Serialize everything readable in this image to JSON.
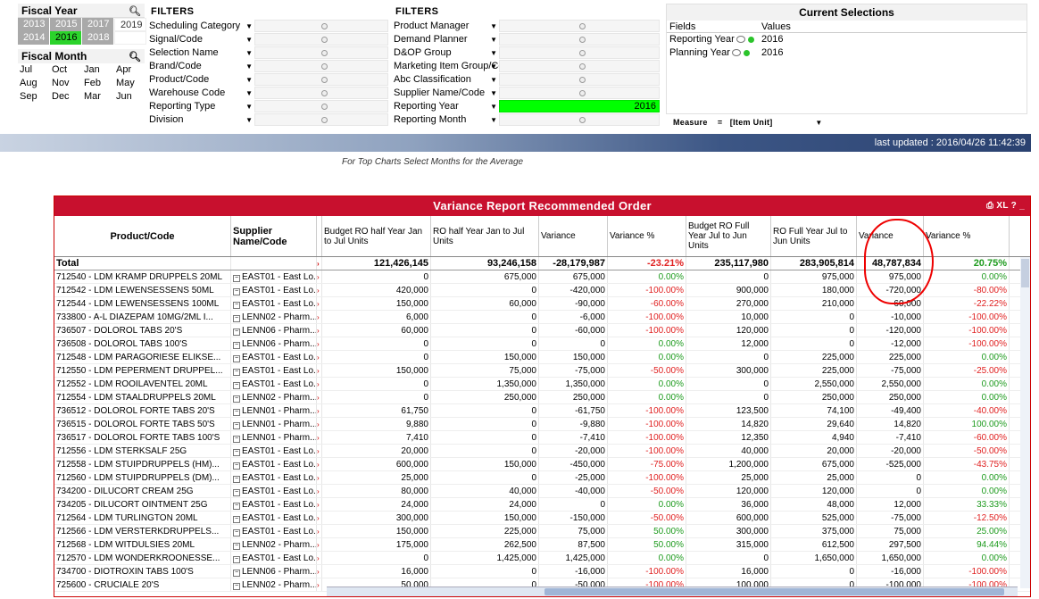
{
  "fiscal_year": {
    "title": "Fiscal Year",
    "years": [
      {
        "label": "2013",
        "state": "gray"
      },
      {
        "label": "2015",
        "state": "gray"
      },
      {
        "label": "2017",
        "state": "gray"
      },
      {
        "label": "2019",
        "state": "white"
      },
      {
        "label": "2014",
        "state": "gray"
      },
      {
        "label": "2016",
        "state": "sel"
      },
      {
        "label": "2018",
        "state": "gray"
      },
      {
        "label": "",
        "state": "white"
      }
    ]
  },
  "fiscal_month": {
    "title": "Fiscal Month",
    "months": [
      "Jul",
      "Oct",
      "Jan",
      "Apr",
      "Aug",
      "Nov",
      "Feb",
      "May",
      "Sep",
      "Dec",
      "Mar",
      "Jun"
    ]
  },
  "filters1": {
    "title": "FILTERS",
    "rows": [
      {
        "label": "Scheduling Category",
        "value": ""
      },
      {
        "label": "Signal/Code",
        "value": ""
      },
      {
        "label": "Selection Name",
        "value": ""
      },
      {
        "label": "Brand/Code",
        "value": ""
      },
      {
        "label": "Product/Code",
        "value": ""
      },
      {
        "label": "Warehouse Code",
        "value": ""
      },
      {
        "label": "Reporting Type",
        "value": ""
      },
      {
        "label": "Division",
        "value": ""
      }
    ]
  },
  "filters2": {
    "title": "FILTERS",
    "rows": [
      {
        "label": "Product Manager",
        "value": ""
      },
      {
        "label": "Demand Planner",
        "value": ""
      },
      {
        "label": "D&OP Group",
        "value": ""
      },
      {
        "label": "Marketing Item Group/Code",
        "value": ""
      },
      {
        "label": "Abc Classification",
        "value": ""
      },
      {
        "label": "Supplier Name/Code",
        "value": ""
      },
      {
        "label": "Reporting Year",
        "value": "2016",
        "green": true
      },
      {
        "label": "Reporting Month",
        "value": ""
      }
    ]
  },
  "current_selections": {
    "title": "Current Selections",
    "fields_header": "Fields",
    "values_header": "Values",
    "rows": [
      {
        "field": "Reporting Year",
        "value": "2016"
      },
      {
        "field": "Planning Year",
        "value": "2016"
      }
    ]
  },
  "measure": {
    "label": "Measure",
    "eq": "=",
    "value": "[Item Unit]"
  },
  "last_updated": "last updated : 2016/04/26 11:42:39",
  "note": "For Top Charts Select Months for the Average",
  "report": {
    "title": "Variance Report Recommended Order",
    "icons": "XL ? _",
    "headers": [
      "Product/Code",
      "Supplier Name/Code",
      "Budget RO half Year Jan to Jul Units",
      "RO half Year Jan to Jul Units",
      "Variance",
      "Variance %",
      "Budget RO Full Year Jul to Jun Units",
      "RO Full Year Jul to Jun Units",
      "Variance",
      "Variance %"
    ],
    "total": [
      "Total",
      "",
      "121,426,145",
      "93,246,158",
      "-28,179,987",
      "-23.21%",
      "235,117,980",
      "283,905,814",
      "48,787,834",
      "20.75%"
    ],
    "rows": [
      [
        "712540 - LDM KRAMP DRUPPELS 20ML",
        "EAST01 - East Lo...",
        "0",
        "675,000",
        "675,000",
        "0.00%",
        "0",
        "975,000",
        "975,000",
        "0.00%"
      ],
      [
        "712542 - LDM LEWENSESSENS 50ML",
        "EAST01 - East Lo...",
        "420,000",
        "0",
        "-420,000",
        "-100.00%",
        "900,000",
        "180,000",
        "-720,000",
        "-80.00%"
      ],
      [
        "712544 - LDM LEWENSESSENS 100ML",
        "EAST01 - East Lo...",
        "150,000",
        "60,000",
        "-90,000",
        "-60.00%",
        "270,000",
        "210,000",
        "-60,000",
        "-22.22%"
      ],
      [
        "733800 - A-L DIAZEPAM 10MG/2ML I...",
        "LENN02 - Pharm...",
        "6,000",
        "0",
        "-6,000",
        "-100.00%",
        "10,000",
        "0",
        "-10,000",
        "-100.00%"
      ],
      [
        "736507 - DOLOROL TABS 20'S",
        "LENN06 - Pharm...",
        "60,000",
        "0",
        "-60,000",
        "-100.00%",
        "120,000",
        "0",
        "-120,000",
        "-100.00%"
      ],
      [
        "736508 - DOLOROL TABS 100'S",
        "LENN06 - Pharm...",
        "0",
        "0",
        "0",
        "0.00%",
        "12,000",
        "0",
        "-12,000",
        "-100.00%"
      ],
      [
        "712548 - LDM PARAGORIESE ELIKSE...",
        "EAST01 - East Lo...",
        "0",
        "150,000",
        "150,000",
        "0.00%",
        "0",
        "225,000",
        "225,000",
        "0.00%"
      ],
      [
        "712550 - LDM PEPERMENT DRUPPEL...",
        "EAST01 - East Lo...",
        "150,000",
        "75,000",
        "-75,000",
        "-50.00%",
        "300,000",
        "225,000",
        "-75,000",
        "-25.00%"
      ],
      [
        "712552 - LDM ROOILAVENTEL 20ML",
        "EAST01 - East Lo...",
        "0",
        "1,350,000",
        "1,350,000",
        "0.00%",
        "0",
        "2,550,000",
        "2,550,000",
        "0.00%"
      ],
      [
        "712554 - LDM STAALDRUPPELS 20ML",
        "LENN02 - Pharm...",
        "0",
        "250,000",
        "250,000",
        "0.00%",
        "0",
        "250,000",
        "250,000",
        "0.00%"
      ],
      [
        "736512 - DOLOROL FORTE TABS 20'S",
        "LENN01 - Pharm...",
        "61,750",
        "0",
        "-61,750",
        "-100.00%",
        "123,500",
        "74,100",
        "-49,400",
        "-40.00%"
      ],
      [
        "736515 - DOLOROL FORTE TABS 50'S",
        "LENN01 - Pharm...",
        "9,880",
        "0",
        "-9,880",
        "-100.00%",
        "14,820",
        "29,640",
        "14,820",
        "100.00%"
      ],
      [
        "736517 - DOLOROL FORTE TABS 100'S",
        "LENN01 - Pharm...",
        "7,410",
        "0",
        "-7,410",
        "-100.00%",
        "12,350",
        "4,940",
        "-7,410",
        "-60.00%"
      ],
      [
        "712556 - LDM STERKSALF 25G",
        "EAST01 - East Lo...",
        "20,000",
        "0",
        "-20,000",
        "-100.00%",
        "40,000",
        "20,000",
        "-20,000",
        "-50.00%"
      ],
      [
        "712558 - LDM STUIPDRUPPELS (HM)...",
        "EAST01 - East Lo...",
        "600,000",
        "150,000",
        "-450,000",
        "-75.00%",
        "1,200,000",
        "675,000",
        "-525,000",
        "-43.75%"
      ],
      [
        "712560 - LDM STUIPDRUPPELS (DM)...",
        "EAST01 - East Lo...",
        "25,000",
        "0",
        "-25,000",
        "-100.00%",
        "25,000",
        "25,000",
        "0",
        "0.00%"
      ],
      [
        "734200 - DILUCORT CREAM 25G",
        "EAST01 - East Lo...",
        "80,000",
        "40,000",
        "-40,000",
        "-50.00%",
        "120,000",
        "120,000",
        "0",
        "0.00%"
      ],
      [
        "734205 - DILUCORT OINTMENT 25G",
        "EAST01 - East Lo...",
        "24,000",
        "24,000",
        "0",
        "0.00%",
        "36,000",
        "48,000",
        "12,000",
        "33.33%"
      ],
      [
        "712564 - LDM TURLINGTON 20ML",
        "EAST01 - East Lo...",
        "300,000",
        "150,000",
        "-150,000",
        "-50.00%",
        "600,000",
        "525,000",
        "-75,000",
        "-12.50%"
      ],
      [
        "712566 - LDM VERSTERKDRUPPELS...",
        "EAST01 - East Lo...",
        "150,000",
        "225,000",
        "75,000",
        "50.00%",
        "300,000",
        "375,000",
        "75,000",
        "25.00%"
      ],
      [
        "712568 - LDM WITDULSIES 20ML",
        "LENN02 - Pharm...",
        "175,000",
        "262,500",
        "87,500",
        "50.00%",
        "315,000",
        "612,500",
        "297,500",
        "94.44%"
      ],
      [
        "712570 - LDM WONDERKROONESSE...",
        "EAST01 - East Lo...",
        "0",
        "1,425,000",
        "1,425,000",
        "0.00%",
        "0",
        "1,650,000",
        "1,650,000",
        "0.00%"
      ],
      [
        "734700 - DIOTROXIN TABS 100'S",
        "LENN06 - Pharm...",
        "16,000",
        "0",
        "-16,000",
        "-100.00%",
        "16,000",
        "0",
        "-16,000",
        "-100.00%"
      ],
      [
        "725600 - CRUCIALE 20'S",
        "LENN02 - Pharm...",
        "50,000",
        "0",
        "-50,000",
        "-100.00%",
        "100,000",
        "0",
        "-100,000",
        "-100.00%"
      ]
    ]
  }
}
